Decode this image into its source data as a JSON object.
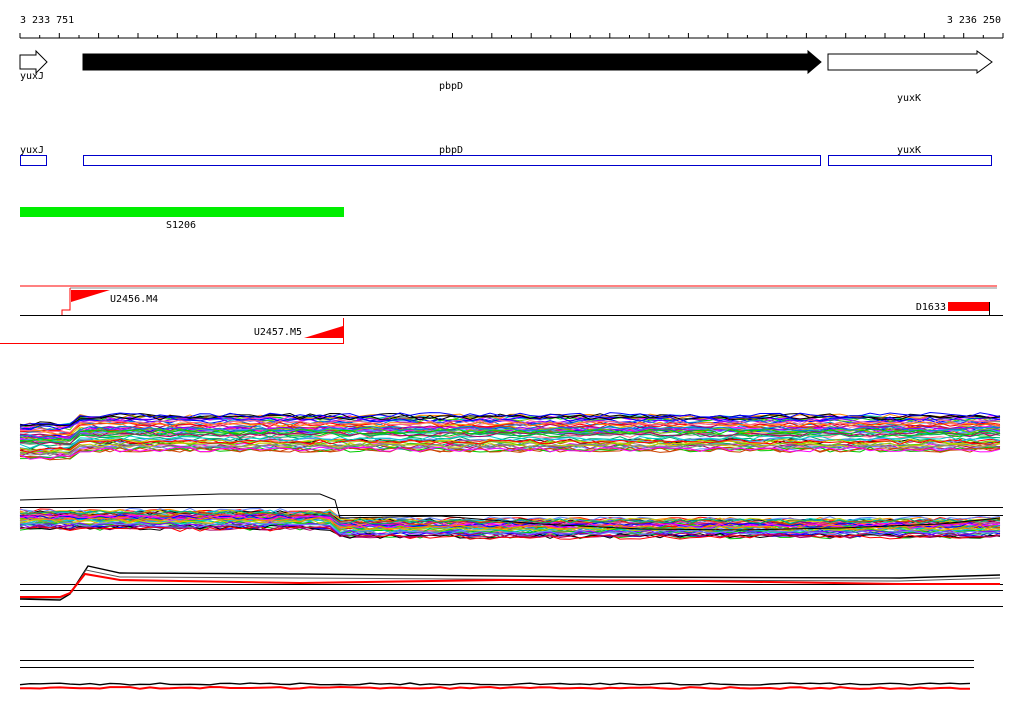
{
  "ruler": {
    "start_label": "3 233 751",
    "end_label": "3 236 250"
  },
  "genes": [
    {
      "name": "yuxJ",
      "strand": "+",
      "fill": "#ffffff"
    },
    {
      "name": "pbpD",
      "strand": "+",
      "fill": "#000000"
    },
    {
      "name": "yuxK",
      "strand": "+",
      "fill": "#ffffff"
    }
  ],
  "annotations": [
    {
      "name": "yuxJ",
      "color": "#0000cc"
    },
    {
      "name": "pbpD",
      "color": "#0000cc"
    },
    {
      "name": "yuxK",
      "color": "#0000cc"
    }
  ],
  "segment": {
    "name": "S1206",
    "color": "#00ee00"
  },
  "transcripts": [
    {
      "name": "U2456.M4",
      "color": "#ff0000"
    },
    {
      "name": "U2457.M5",
      "color": "#ff0000"
    },
    {
      "name": "D1633",
      "color": "#ff0000"
    }
  ],
  "colors": {
    "baseline": "#000000",
    "signal": "#ff0000"
  }
}
